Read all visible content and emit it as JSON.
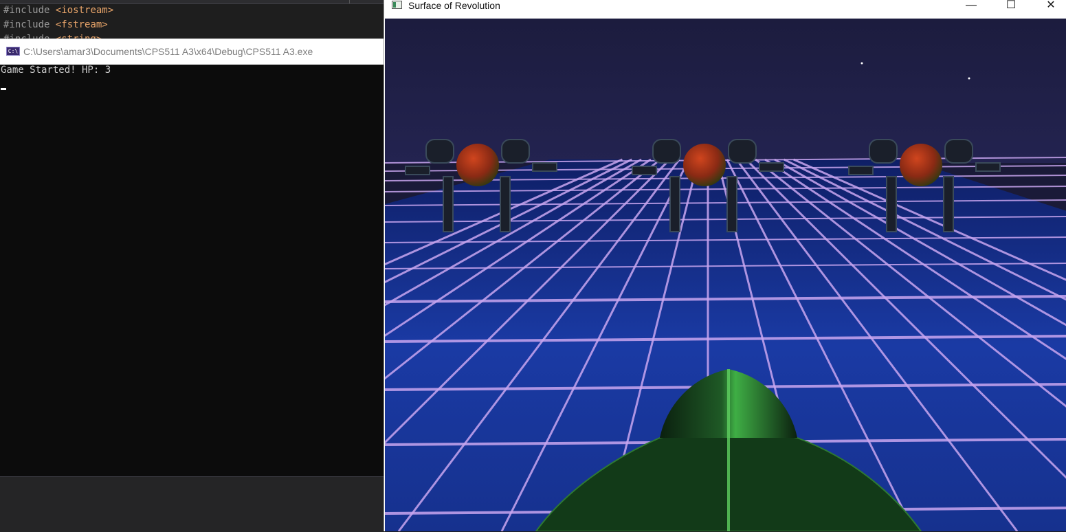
{
  "editor": {
    "lines": [
      {
        "directive": "#include",
        "header": "<iostream>"
      },
      {
        "directive": "#include",
        "header": "<fstream>"
      },
      {
        "directive": "#include",
        "header": "<string>"
      }
    ]
  },
  "console": {
    "icon_label": "C:\\",
    "title": "C:\\Users\\amar3\\Documents\\CPS511 A3\\x64\\Debug\\CPS511 A3.exe",
    "output": "Game Started! HP: 3"
  },
  "game_window": {
    "title": "Surface of Revolution",
    "minimize_symbol": "—",
    "maximize_symbol": "☐",
    "close_symbol": "✕"
  },
  "scene": {
    "sky_color": "#1b1b3a",
    "grid_line_color": "#c9a6f0",
    "tile_color": "#1b3ea8",
    "cannon_color": "#1f6a2a",
    "robot_count": 3,
    "robot_head_color": "#b5321a"
  }
}
